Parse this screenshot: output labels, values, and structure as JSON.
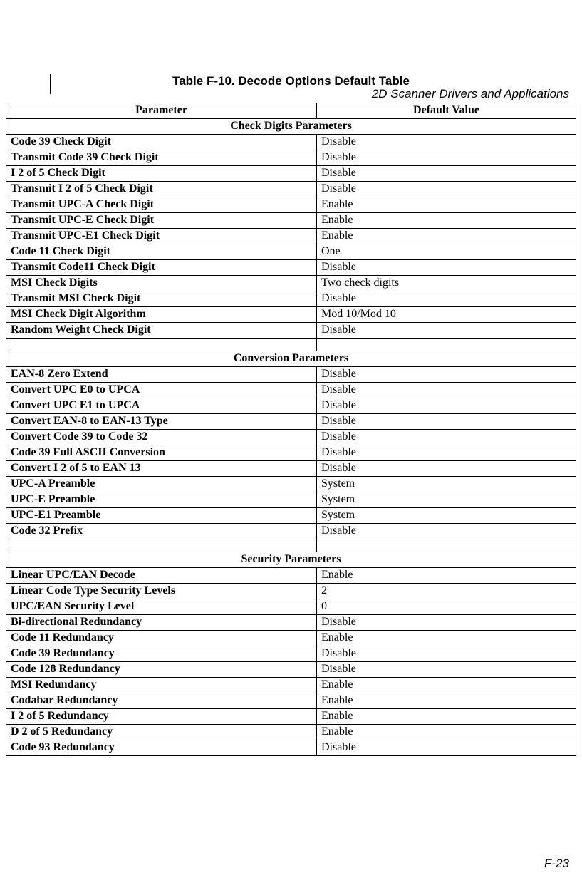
{
  "header": "2D Scanner Drivers and Applications",
  "table_title": "Table F-10. Decode Options Default Table",
  "columns": [
    "Parameter",
    "Default Value"
  ],
  "sections": [
    {
      "title": "Check Digits Parameters",
      "rows": [
        {
          "param": "Code 39 Check Digit",
          "value": "Disable"
        },
        {
          "param": "Transmit Code 39 Check Digit",
          "value": "Disable"
        },
        {
          "param": "I 2 of 5 Check Digit",
          "value": "Disable"
        },
        {
          "param": "Transmit I 2 of 5 Check Digit",
          "value": "Disable"
        },
        {
          "param": "Transmit UPC-A Check Digit",
          "value": "Enable"
        },
        {
          "param": "Transmit UPC-E Check Digit",
          "value": "Enable"
        },
        {
          "param": "Transmit UPC-E1 Check Digit",
          "value": "Enable"
        },
        {
          "param": "Code 11 Check Digit",
          "value": "One"
        },
        {
          "param": "Transmit Code11 Check Digit",
          "value": "Disable"
        },
        {
          "param": "MSI Check Digits",
          "value": "Two check digits"
        },
        {
          "param": "Transmit MSI Check Digit",
          "value": "Disable"
        },
        {
          "param": "MSI Check Digit Algorithm",
          "value": "Mod 10/Mod 10"
        },
        {
          "param": "Random Weight Check Digit",
          "value": "Disable"
        }
      ]
    },
    {
      "title": "Conversion Parameters",
      "rows": [
        {
          "param": "EAN-8 Zero Extend",
          "value": "Disable"
        },
        {
          "param": "Convert UPC E0 to UPCA",
          "value": "Disable"
        },
        {
          "param": "Convert UPC E1 to UPCA",
          "value": "Disable"
        },
        {
          "param": "Convert EAN-8 to EAN-13 Type",
          "value": "Disable"
        },
        {
          "param": "Convert Code 39 to Code 32",
          "value": "Disable"
        },
        {
          "param": "Code 39 Full ASCII Conversion",
          "value": "Disable"
        },
        {
          "param": "Convert I 2 of 5 to EAN 13",
          "value": "Disable"
        },
        {
          "param": "UPC-A Preamble",
          "value": "System"
        },
        {
          "param": "UPC-E Preamble",
          "value": "System"
        },
        {
          "param": "UPC-E1 Preamble",
          "value": "System"
        },
        {
          "param": "Code 32 Prefix",
          "value": "Disable"
        }
      ]
    },
    {
      "title": "Security Parameters",
      "rows": [
        {
          "param": "Linear UPC/EAN Decode",
          "value": "Enable"
        },
        {
          "param": "Linear Code Type Security Levels",
          "value": "2"
        },
        {
          "param": "UPC/EAN Security Level",
          "value": "0"
        },
        {
          "param": "Bi-directional Redundancy",
          "value": "Disable"
        },
        {
          "param": "Code 11 Redundancy",
          "value": "Enable"
        },
        {
          "param": "Code 39 Redundancy",
          "value": "Disable"
        },
        {
          "param": "Code 128 Redundancy",
          "value": "Disable"
        },
        {
          "param": "MSI Redundancy",
          "value": "Enable"
        },
        {
          "param": "Codabar Redundancy",
          "value": "Enable"
        },
        {
          "param": "I 2 of 5 Redundancy",
          "value": "Enable"
        },
        {
          "param": "D 2 of 5 Redundancy",
          "value": "Enable"
        },
        {
          "param": "Code 93 Redundancy",
          "value": "Disable"
        }
      ]
    }
  ],
  "page_number": "F-23"
}
